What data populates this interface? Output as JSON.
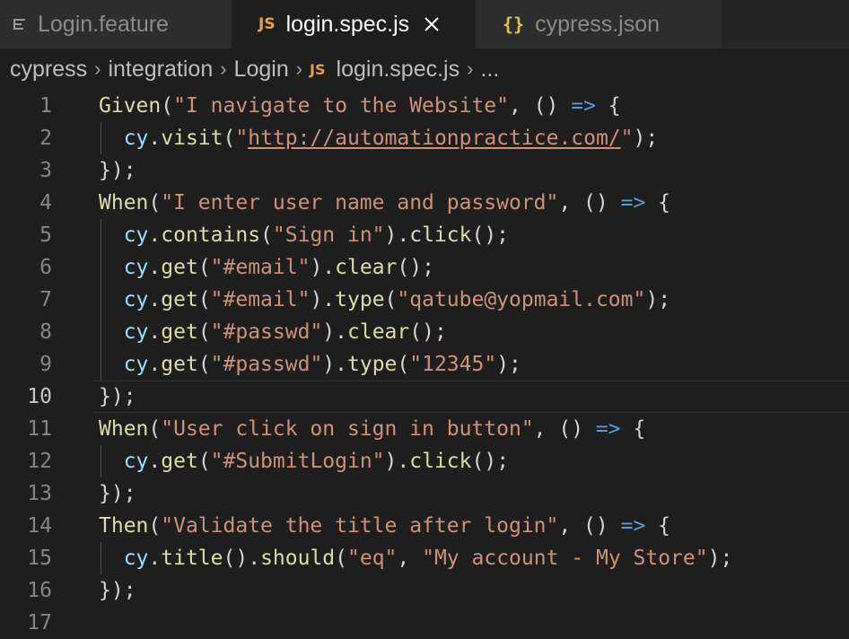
{
  "tabs": [
    {
      "label": "Login.feature",
      "icon": "feature-file-icon"
    },
    {
      "label": "login.spec.js",
      "icon": "js-file-icon",
      "icon_text": "JS",
      "close": "×"
    },
    {
      "label": "cypress.json",
      "icon": "json-file-icon",
      "icon_text": "{}"
    }
  ],
  "breadcrumb": {
    "items": [
      "cypress",
      "integration",
      "Login"
    ],
    "file_icon_text": "JS",
    "file": "login.spec.js",
    "more": "..."
  },
  "editor": {
    "active_line": 10,
    "lines": [
      {
        "n": "1",
        "tokens": [
          [
            "fn",
            "Given"
          ],
          [
            "p",
            "("
          ],
          [
            "str",
            "\"I navigate to the Website\""
          ],
          [
            "p",
            ", () "
          ],
          [
            "kw",
            "=>"
          ],
          [
            "p",
            " {"
          ]
        ]
      },
      {
        "n": "2",
        "tokens": [
          [
            "p",
            "  "
          ],
          [
            "var",
            "cy"
          ],
          [
            "p",
            "."
          ],
          [
            "fn",
            "visit"
          ],
          [
            "p",
            "("
          ],
          [
            "str",
            "\""
          ],
          [
            "url",
            "http://automationpractice.com/"
          ],
          [
            "str",
            "\""
          ],
          [
            "p",
            ");"
          ]
        ]
      },
      {
        "n": "3",
        "tokens": [
          [
            "p",
            "});"
          ]
        ]
      },
      {
        "n": "4",
        "tokens": [
          [
            "fn",
            "When"
          ],
          [
            "p",
            "("
          ],
          [
            "str",
            "\"I enter user name and password\""
          ],
          [
            "p",
            ", () "
          ],
          [
            "kw",
            "=>"
          ],
          [
            "p",
            " {"
          ]
        ]
      },
      {
        "n": "5",
        "tokens": [
          [
            "p",
            "  "
          ],
          [
            "var",
            "cy"
          ],
          [
            "p",
            "."
          ],
          [
            "fn",
            "contains"
          ],
          [
            "p",
            "("
          ],
          [
            "str",
            "\"Sign in\""
          ],
          [
            "p",
            ")."
          ],
          [
            "fn",
            "click"
          ],
          [
            "p",
            "();"
          ]
        ]
      },
      {
        "n": "6",
        "tokens": [
          [
            "p",
            "  "
          ],
          [
            "var",
            "cy"
          ],
          [
            "p",
            "."
          ],
          [
            "fn",
            "get"
          ],
          [
            "p",
            "("
          ],
          [
            "str",
            "\"#email\""
          ],
          [
            "p",
            ")."
          ],
          [
            "fn",
            "clear"
          ],
          [
            "p",
            "();"
          ]
        ]
      },
      {
        "n": "7",
        "tokens": [
          [
            "p",
            "  "
          ],
          [
            "var",
            "cy"
          ],
          [
            "p",
            "."
          ],
          [
            "fn",
            "get"
          ],
          [
            "p",
            "("
          ],
          [
            "str",
            "\"#email\""
          ],
          [
            "p",
            ")."
          ],
          [
            "fn",
            "type"
          ],
          [
            "p",
            "("
          ],
          [
            "str",
            "\"qatube@yopmail.com\""
          ],
          [
            "p",
            ");"
          ]
        ]
      },
      {
        "n": "8",
        "tokens": [
          [
            "p",
            "  "
          ],
          [
            "var",
            "cy"
          ],
          [
            "p",
            "."
          ],
          [
            "fn",
            "get"
          ],
          [
            "p",
            "("
          ],
          [
            "str",
            "\"#passwd\""
          ],
          [
            "p",
            ")."
          ],
          [
            "fn",
            "clear"
          ],
          [
            "p",
            "();"
          ]
        ]
      },
      {
        "n": "9",
        "tokens": [
          [
            "p",
            "  "
          ],
          [
            "var",
            "cy"
          ],
          [
            "p",
            "."
          ],
          [
            "fn",
            "get"
          ],
          [
            "p",
            "("
          ],
          [
            "str",
            "\"#passwd\""
          ],
          [
            "p",
            ")."
          ],
          [
            "fn",
            "type"
          ],
          [
            "p",
            "("
          ],
          [
            "str",
            "\"12345\""
          ],
          [
            "p",
            ");"
          ]
        ]
      },
      {
        "n": "10",
        "tokens": [
          [
            "p",
            "});"
          ]
        ]
      },
      {
        "n": "11",
        "tokens": [
          [
            "fn",
            "When"
          ],
          [
            "p",
            "("
          ],
          [
            "str",
            "\"User click on sign in button\""
          ],
          [
            "p",
            ", () "
          ],
          [
            "kw",
            "=>"
          ],
          [
            "p",
            " {"
          ]
        ]
      },
      {
        "n": "12",
        "tokens": [
          [
            "p",
            "  "
          ],
          [
            "var",
            "cy"
          ],
          [
            "p",
            "."
          ],
          [
            "fn",
            "get"
          ],
          [
            "p",
            "("
          ],
          [
            "str",
            "\"#SubmitLogin\""
          ],
          [
            "p",
            ")."
          ],
          [
            "fn",
            "click"
          ],
          [
            "p",
            "();"
          ]
        ]
      },
      {
        "n": "13",
        "tokens": [
          [
            "p",
            "});"
          ]
        ]
      },
      {
        "n": "14",
        "tokens": [
          [
            "fn",
            "Then"
          ],
          [
            "p",
            "("
          ],
          [
            "str",
            "\"Validate the title after login\""
          ],
          [
            "p",
            ", () "
          ],
          [
            "kw",
            "=>"
          ],
          [
            "p",
            " {"
          ]
        ]
      },
      {
        "n": "15",
        "tokens": [
          [
            "p",
            "  "
          ],
          [
            "var",
            "cy"
          ],
          [
            "p",
            "."
          ],
          [
            "fn",
            "title"
          ],
          [
            "p",
            "()."
          ],
          [
            "fn",
            "should"
          ],
          [
            "p",
            "("
          ],
          [
            "str",
            "\"eq\""
          ],
          [
            "p",
            ", "
          ],
          [
            "str",
            "\"My account - My Store\""
          ],
          [
            "p",
            ");"
          ]
        ]
      },
      {
        "n": "16",
        "tokens": [
          [
            "p",
            "});"
          ]
        ]
      },
      {
        "n": "17",
        "tokens": []
      }
    ]
  }
}
